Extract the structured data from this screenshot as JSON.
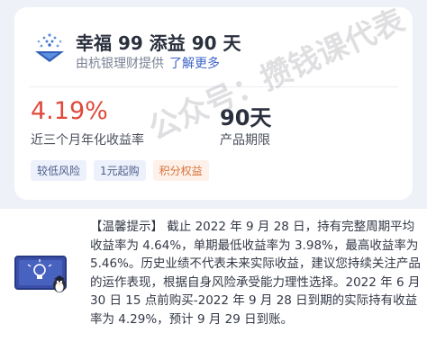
{
  "product": {
    "name": "幸福 99 添益 90 天",
    "provider": "由杭银理财提供",
    "learn_more": "了解更多"
  },
  "metrics": {
    "rate_value": "4.19%",
    "rate_label": "近三个月年化收益率",
    "term_value": "90天",
    "term_label": "产品期限"
  },
  "tags": [
    "较低风险",
    "1元起购",
    "积分权益"
  ],
  "watermark": "公众号：攒钱课代表",
  "tips": {
    "text": "【温馨提示】 截止 2022 年 9 月 28 日，持有完整周期平均收益率为 4.64%，单期最低收益率为 3.98%，最高收益率为 5.46%。历史业绩不代表未来实际收益，建议您持续关注产品的运作表现，根据自身风险承受能力理性选择。2022 年 6 月 30 日 15 点前购买-2022 年 9 月 28 日到期的实际持有收益率为 4.29%，预计 9 月 29 日到账。"
  },
  "colors": {
    "rate": "#e0493b",
    "link": "#3d64c8",
    "points_tag": "#d9723b"
  },
  "icons": {
    "logo": "hangyin-logo-icon",
    "board": "chalkboard-lightbulb-icon",
    "mascot": "penguin-mascot-icon"
  }
}
